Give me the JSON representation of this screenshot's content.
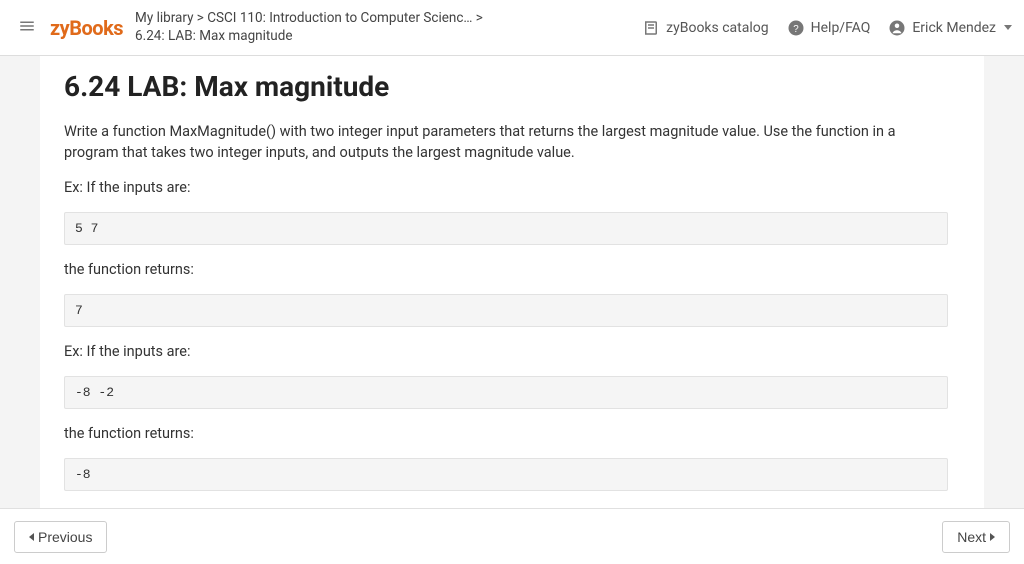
{
  "header": {
    "logo": "zyBooks",
    "breadcrumb_line1": "My library > CSCI 110: Introduction to Computer Scienc… >",
    "breadcrumb_line2": "6.24: LAB: Max magnitude",
    "catalog_label": "zyBooks catalog",
    "help_label": "Help/FAQ",
    "user_name": "Erick Mendez"
  },
  "page": {
    "title": "6.24 LAB: Max magnitude",
    "intro": "Write a function MaxMagnitude() with two integer input parameters that returns the largest magnitude value. Use the function in a program that takes two integer inputs, and outputs the largest magnitude value.",
    "ex1_label": "Ex: If the inputs are:",
    "ex1_code": "5 7",
    "ret1_label": "the function returns:",
    "ret1_code": "7",
    "ex2_label": "Ex: If the inputs are:",
    "ex2_code": "-8 -2",
    "ret2_label": "the function returns:",
    "ret2_code": "-8"
  },
  "nav": {
    "prev": "Previous",
    "next": "Next"
  }
}
